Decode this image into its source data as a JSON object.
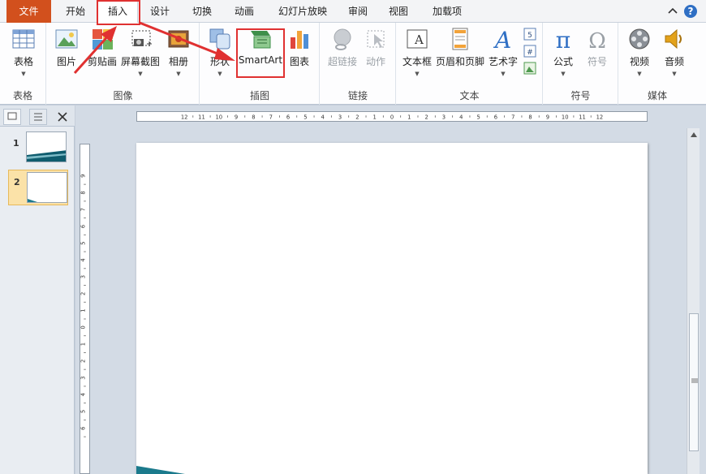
{
  "tabs": {
    "file": "文件",
    "items": [
      "开始",
      "插入",
      "设计",
      "切换",
      "动画",
      "幻灯片放映",
      "审阅",
      "视图",
      "加载项"
    ]
  },
  "ribbon": {
    "groups": {
      "table": "表格",
      "images": "图像",
      "illustrations": "插图",
      "links": "链接",
      "text": "文本",
      "symbols": "符号",
      "media": "媒体"
    },
    "buttons": {
      "table": "表格",
      "picture": "图片",
      "clipart": "剪贴画",
      "screenshot": "屏幕截图",
      "album": "相册",
      "shapes": "形状",
      "smartart": "SmartArt",
      "chart": "图表",
      "hyperlink": "超链接",
      "action": "动作",
      "textbox": "文本框",
      "header_footer": "页眉和页脚",
      "wordart": "艺术字",
      "equation": "公式",
      "symbol": "符号",
      "video": "视频",
      "audio": "音频"
    }
  },
  "slides_panel": {
    "slides": [
      {
        "number": "1"
      },
      {
        "number": "2"
      }
    ]
  },
  "ruler": {
    "horizontal_labels": [
      "12",
      "11",
      "10",
      "9",
      "8",
      "7",
      "6",
      "5",
      "4",
      "3",
      "2",
      "1",
      "0",
      "1",
      "2",
      "3",
      "4",
      "5",
      "6",
      "7",
      "8",
      "9",
      "10",
      "11",
      "12"
    ],
    "vertical_labels": [
      "9",
      "8",
      "7",
      "6",
      "5",
      "4",
      "3",
      "2",
      "1",
      "0",
      "1",
      "2",
      "3",
      "4",
      "5",
      "6"
    ]
  },
  "colors": {
    "file_tab": "#d2501d",
    "annotation": "#e03131",
    "accent_teal": "#1b7a8c"
  }
}
